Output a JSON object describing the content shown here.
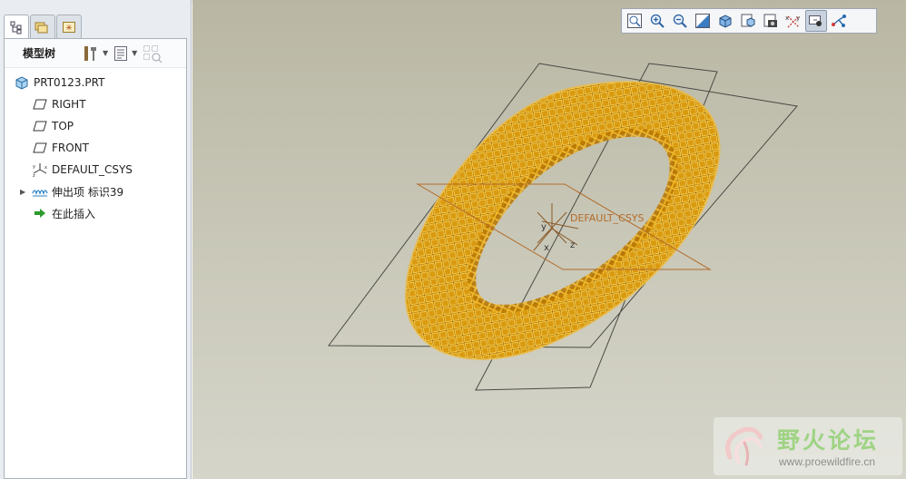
{
  "navigator": {
    "tabs": [
      {
        "name": "model-tree-tab",
        "icon": "model-tree-icon",
        "active": true
      },
      {
        "name": "folder-browser-tab",
        "icon": "folder-browser-icon",
        "active": false
      },
      {
        "name": "favorites-tab",
        "icon": "favorites-icon",
        "active": false
      }
    ],
    "tree_title": "模型树",
    "tree_toolbar": [
      "settings-icon",
      "show-icon",
      "filter-icon"
    ],
    "tree_items": [
      {
        "label": "PRT0123.PRT",
        "icon": "part-icon",
        "level": 0
      },
      {
        "label": "RIGHT",
        "icon": "datum-plane-icon",
        "level": 1
      },
      {
        "label": "TOP",
        "icon": "datum-plane-icon",
        "level": 1
      },
      {
        "label": "FRONT",
        "icon": "datum-plane-icon",
        "level": 1
      },
      {
        "label": "DEFAULT_CSYS",
        "icon": "csys-icon",
        "level": 1
      },
      {
        "label": "伸出项 标识39",
        "icon": "protrusion-icon",
        "level": 1,
        "expandable": true
      },
      {
        "label": "在此插入",
        "icon": "insert-here-arrow-icon",
        "level": 1
      }
    ]
  },
  "view_toolbar": [
    {
      "name": "refit-button",
      "icon": "refit-icon"
    },
    {
      "name": "zoom-in-button",
      "icon": "zoom-in-icon"
    },
    {
      "name": "zoom-out-button",
      "icon": "zoom-out-icon"
    },
    {
      "name": "repaint-button",
      "icon": "repaint-icon"
    },
    {
      "name": "display-style-button",
      "icon": "display-style-icon"
    },
    {
      "name": "saved-views-button",
      "icon": "saved-views-icon"
    },
    {
      "name": "view-manager-button",
      "icon": "view-manager-icon"
    },
    {
      "name": "datum-display-button",
      "icon": "datum-display-icon"
    },
    {
      "name": "spin-center-button",
      "icon": "spin-center-icon",
      "pressed": true
    },
    {
      "name": "annotation-display-button",
      "icon": "annotation-display-icon"
    }
  ],
  "viewport": {
    "csys_label": "DEFAULT_CSYS",
    "axis_x": "x",
    "axis_y": "y",
    "axis_z": "z"
  },
  "watermark": {
    "title": "野火论坛",
    "url": "www.proewildfire.cn"
  },
  "colors": {
    "model_gold": "#e8a10a",
    "model_dark": "#9a5e00",
    "datum_plane": "#4a4a44",
    "csys_orange": "#b36b2a",
    "watermark_green": "#9ed383"
  }
}
